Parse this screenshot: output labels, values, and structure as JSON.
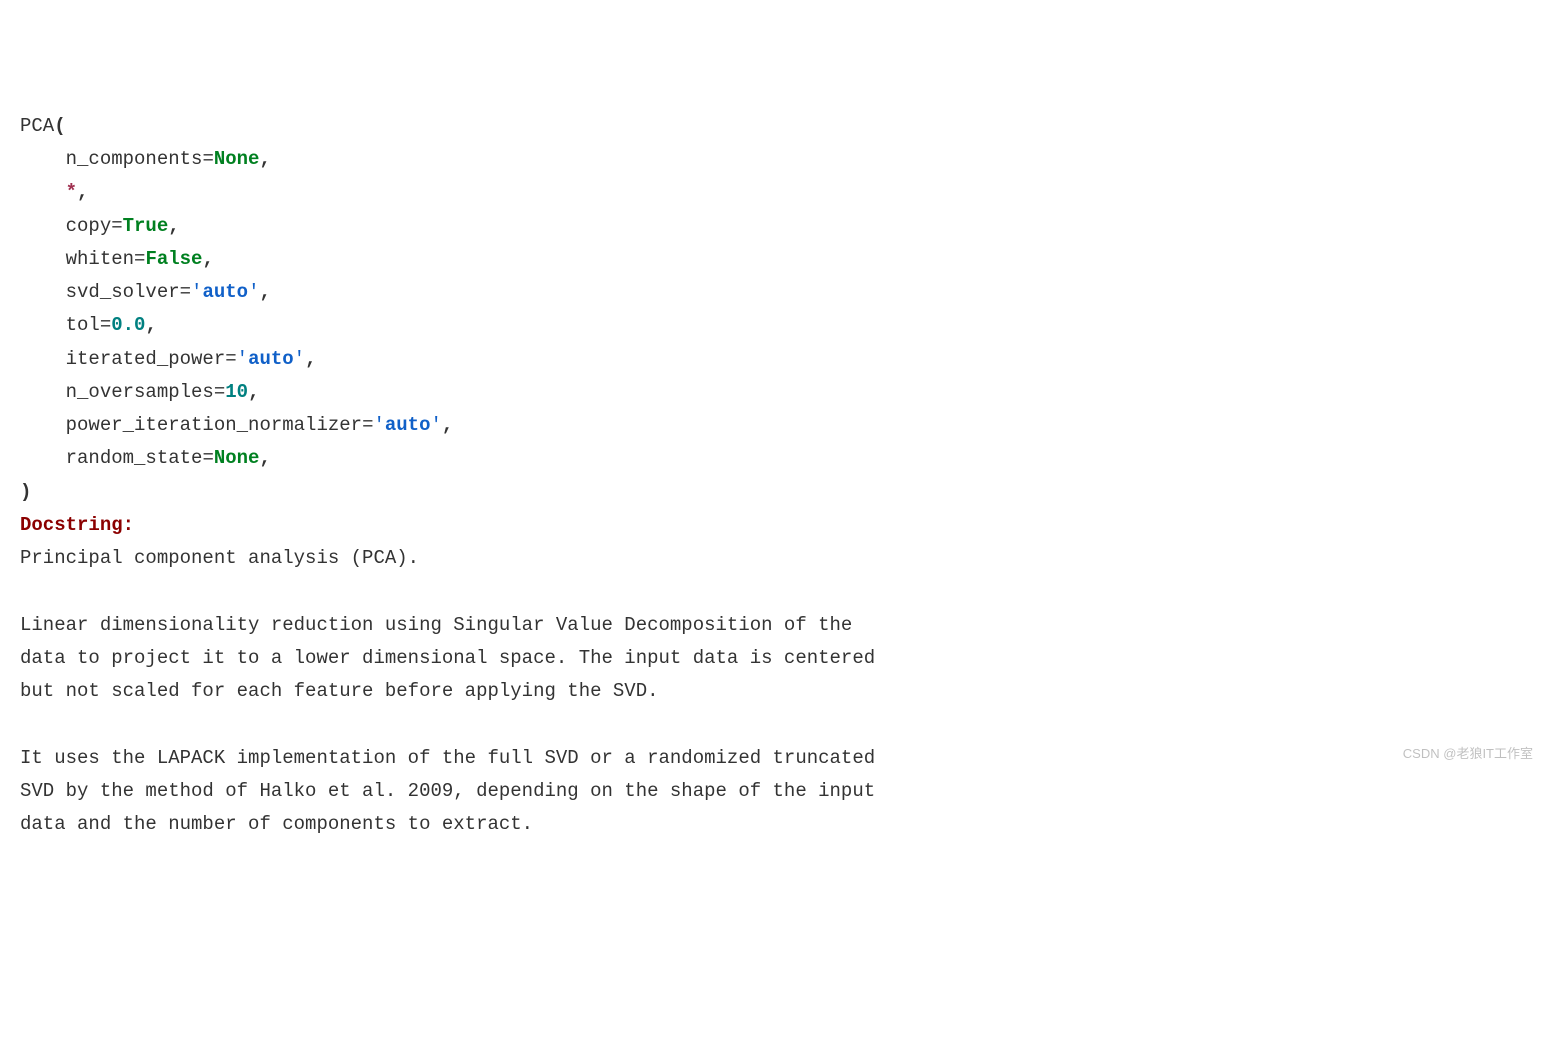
{
  "signature": {
    "func_name": "PCA",
    "open_paren": "(",
    "close_paren": ")",
    "indent": "    ",
    "star": "*",
    "comma": ",",
    "eq": "=",
    "params": [
      {
        "name": "n_components",
        "value": "None",
        "vclass": "k-none"
      },
      {
        "star": true
      },
      {
        "name": "copy",
        "value": "True",
        "vclass": "k-true"
      },
      {
        "name": "whiten",
        "value": "False",
        "vclass": "k-false"
      },
      {
        "name": "svd_solver",
        "value": "auto",
        "vclass": "k-str",
        "quoted": true
      },
      {
        "name": "tol",
        "value": "0.0",
        "vclass": "k-num"
      },
      {
        "name": "iterated_power",
        "value": "auto",
        "vclass": "k-str",
        "quoted": true
      },
      {
        "name": "n_oversamples",
        "value": "10",
        "vclass": "k-num"
      },
      {
        "name": "power_iteration_normalizer",
        "value": "auto",
        "vclass": "k-str",
        "quoted": true
      },
      {
        "name": "random_state",
        "value": "None",
        "vclass": "k-none"
      }
    ]
  },
  "docstring_label": "Docstring:",
  "docstring_body": "Principal component analysis (PCA).\n\nLinear dimensionality reduction using Singular Value Decomposition of the\ndata to project it to a lower dimensional space. The input data is centered\nbut not scaled for each feature before applying the SVD.\n\nIt uses the LAPACK implementation of the full SVD or a randomized truncated\nSVD by the method of Halko et al. 2009, depending on the shape of the input\ndata and the number of components to extract.",
  "watermark": "CSDN @老狼IT工作室"
}
